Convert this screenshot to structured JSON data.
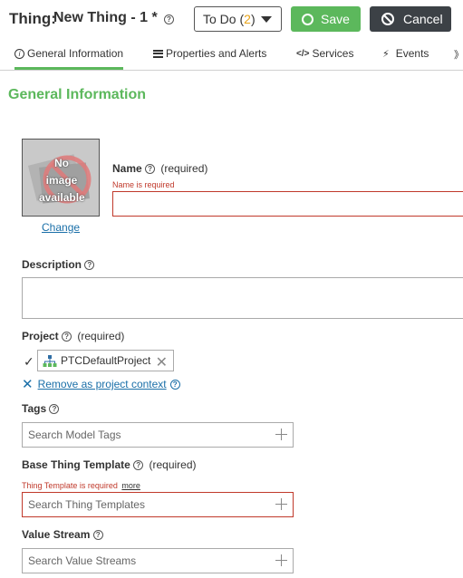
{
  "header": {
    "entity_type": "Thing:",
    "entity_name": "New Thing - 1 *",
    "todo": {
      "label": "To Do",
      "open": "(",
      "count": "2",
      "close": ")"
    },
    "save_label": "Save",
    "cancel_label": "Cancel"
  },
  "tabs": [
    {
      "label": "General Information",
      "icon": "info-icon",
      "active": true
    },
    {
      "label": "Properties and Alerts",
      "icon": "list-icon"
    },
    {
      "label": "Services",
      "icon": "code-icon"
    },
    {
      "label": "Events",
      "icon": "lightning-icon"
    }
  ],
  "section_title": "General Information",
  "image": {
    "placeholder_text": "No image available",
    "change_label": "Change"
  },
  "name_field": {
    "label": "Name",
    "required": "(required)",
    "error": "Name is required",
    "value": ""
  },
  "description_field": {
    "label": "Description",
    "value": ""
  },
  "project_field": {
    "label": "Project",
    "required": "(required)",
    "selected": "PTCDefaultProject",
    "remove_context": "Remove as project context"
  },
  "tags_field": {
    "label": "Tags",
    "placeholder": "Search Model Tags"
  },
  "base_template_field": {
    "label": "Base Thing Template",
    "required": "(required)",
    "error": "Thing Template is required",
    "more": "more",
    "placeholder": "Search Thing Templates"
  },
  "value_stream_field": {
    "label": "Value Stream",
    "placeholder": "Search Value Streams"
  },
  "colors": {
    "accent_green": "#5cb85c",
    "error_red": "#c0392b",
    "link_blue": "#1a6fa8",
    "todo_count": "#e8a317"
  }
}
